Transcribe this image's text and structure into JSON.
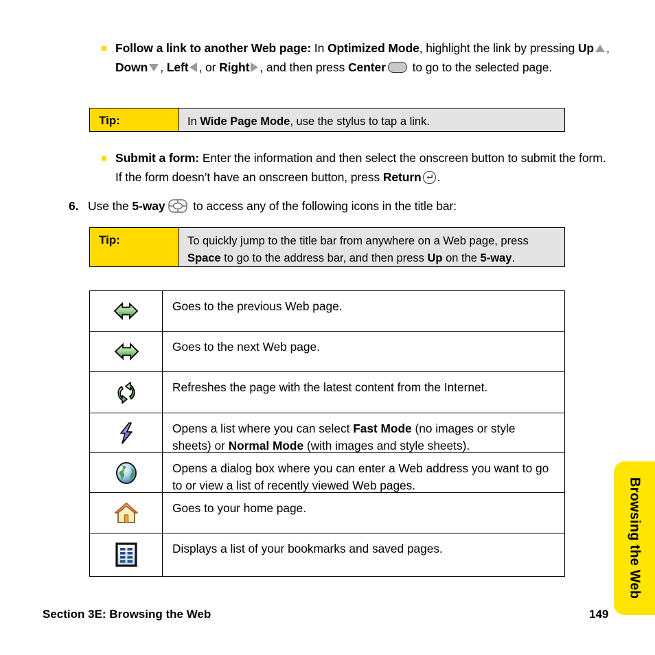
{
  "document": {
    "page_number": "149",
    "footer_section": "Section 3E: Browsing the Web",
    "side_tab": "Browsing the Web",
    "accent_yellow": "#FFD900",
    "tab_yellow": "#FFE500",
    "tip_gray": "#e4e4e4"
  },
  "bullets": [
    {
      "name": "follow-link",
      "lead": "Follow a link to another Web page:",
      "t1": " In ",
      "b1": "Optimized Mode",
      "t2": ", highlight the link by pressing ",
      "b2": "Up",
      "icon1": "triangle-up-icon",
      "t3": ", ",
      "b3": "Down",
      "icon2": "triangle-down-icon",
      "t4": ", ",
      "b4": "Left",
      "icon3": "triangle-left-icon",
      "t5": ", or ",
      "b5": "Right",
      "icon4": "triangle-right-icon",
      "t6": ", and then press ",
      "b6": "Center",
      "icon5": "center-button-icon",
      "t7": " to go to the selected page."
    },
    {
      "name": "submit-form",
      "lead": "Submit a form:",
      "t1": " Enter the information and then select the onscreen button to submit the form. If the form doesn’t have an onscreen button, press ",
      "b1": "Return",
      "icon1": "return-key-icon",
      "t2": "."
    }
  ],
  "step": {
    "number": "6.",
    "t1": "Use the ",
    "b1": "5-way",
    "icon": "five-way-navigator-icon",
    "t2": " to access any of the following icons in the title bar:"
  },
  "tips": [
    {
      "label": "Tip:",
      "t1": "In ",
      "b1": "Wide Page Mode",
      "t2": ", use the stylus to tap a link."
    },
    {
      "label": "Tip:",
      "t1": "To quickly jump to the title bar from anywhere on a Web page, press ",
      "b1": "Space",
      "t2": " to go to the address bar, and then press ",
      "b2": "Up",
      "t3": " on the ",
      "b3": "5-way",
      "t4": "."
    }
  ],
  "icon_table": {
    "rows": [
      {
        "icon": "back-arrow-icon",
        "t1": "Goes to the previous Web page.",
        "b1": "",
        "t2": "",
        "b2": "",
        "t3": ""
      },
      {
        "icon": "forward-arrow-icon",
        "t1": "Goes to the next Web page.",
        "b1": "",
        "t2": "",
        "b2": "",
        "t3": ""
      },
      {
        "icon": "refresh-icon",
        "t1": "Refreshes the page with the latest content from the Internet.",
        "b1": "",
        "t2": "",
        "b2": "",
        "t3": ""
      },
      {
        "icon": "fast-mode-lightning-icon",
        "t1": "Opens a list where you can select ",
        "b1": "Fast Mode",
        "t2": " (no images or style sheets) or ",
        "b2": "Normal Mode",
        "t3": " (with images and style sheets)."
      },
      {
        "icon": "globe-address-icon",
        "t1": "Opens a dialog box where you can enter a Web address you want to go to or view a list of recently viewed Web pages.",
        "b1": "",
        "t2": "",
        "b2": "",
        "t3": ""
      },
      {
        "icon": "home-icon",
        "t1": "Goes to your home page.",
        "b1": "",
        "t2": "",
        "b2": "",
        "t3": ""
      },
      {
        "icon": "bookmarks-icon",
        "t1": "Displays a list of your bookmarks and saved pages.",
        "b1": "",
        "t2": "",
        "b2": "",
        "t3": ""
      }
    ]
  }
}
